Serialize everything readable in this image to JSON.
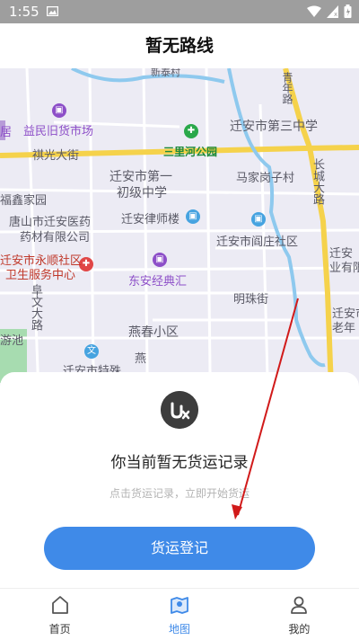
{
  "status_bar": {
    "time": "1:55",
    "icons": [
      "image-icon",
      "wifi-icon",
      "signal-icon",
      "battery-icon"
    ]
  },
  "header": {
    "title": "暂无路线"
  },
  "map": {
    "labels": {
      "xinqin_village": "新泰村",
      "yimin_market": "益民旧货市场",
      "ju": "居",
      "qiguang_street": "祺光大街",
      "sanlihe_park": "三里河公园",
      "qianan_third_middle": "迁安市第三中学",
      "qingnian_road": "青年路",
      "qianan_first_line1": "迁安市第一",
      "qianan_first_line2": "初级中学",
      "majiagangzi": "马家岗子村",
      "changzhu_road": "长城大路",
      "fuxin_garden": "福鑫家园",
      "tangshan_pharma_line1": "唐山市迁安医药",
      "tangshan_pharma_line2": "药材有限公司",
      "lawyer_building": "迁安律师楼",
      "yanzhuang_community": "迁安市阎庄社区",
      "qianan_right_line1": "迁安",
      "qianan_right_line2": "业有限",
      "yongshun_line1": "迁安市永顺社区",
      "yongshun_line2": "卫生服务中心",
      "dongan_jingdian": "东安经典汇",
      "fuwen_road": "阜文大路",
      "mingzhu_street": "明珠街",
      "qianan_elderly_line1": "迁安市",
      "qianan_elderly_line2": "老年",
      "yanchun_district": "燕春小区",
      "swimming_pool": "游池",
      "qianan_special": "迁安市特殊",
      "yan": "燕"
    },
    "colors": {
      "background": "#ecebf4",
      "arterial_road": "#f5d24b",
      "river": "#8ec9ee",
      "park": "#a7dcb0"
    }
  },
  "empty_state": {
    "title": "你当前暂无货运记录",
    "subtitle": "点击货运记录，立即开始货运"
  },
  "cta": {
    "label": "货运登记"
  },
  "tabbar": {
    "tabs": [
      {
        "label": "首页",
        "icon": "home-icon",
        "active": false
      },
      {
        "label": "地图",
        "icon": "map-icon",
        "active": true
      },
      {
        "label": "我的",
        "icon": "user-icon",
        "active": false
      }
    ]
  },
  "colors": {
    "accent": "#3f8ae8",
    "annotation_arrow": "#d11a1a"
  }
}
